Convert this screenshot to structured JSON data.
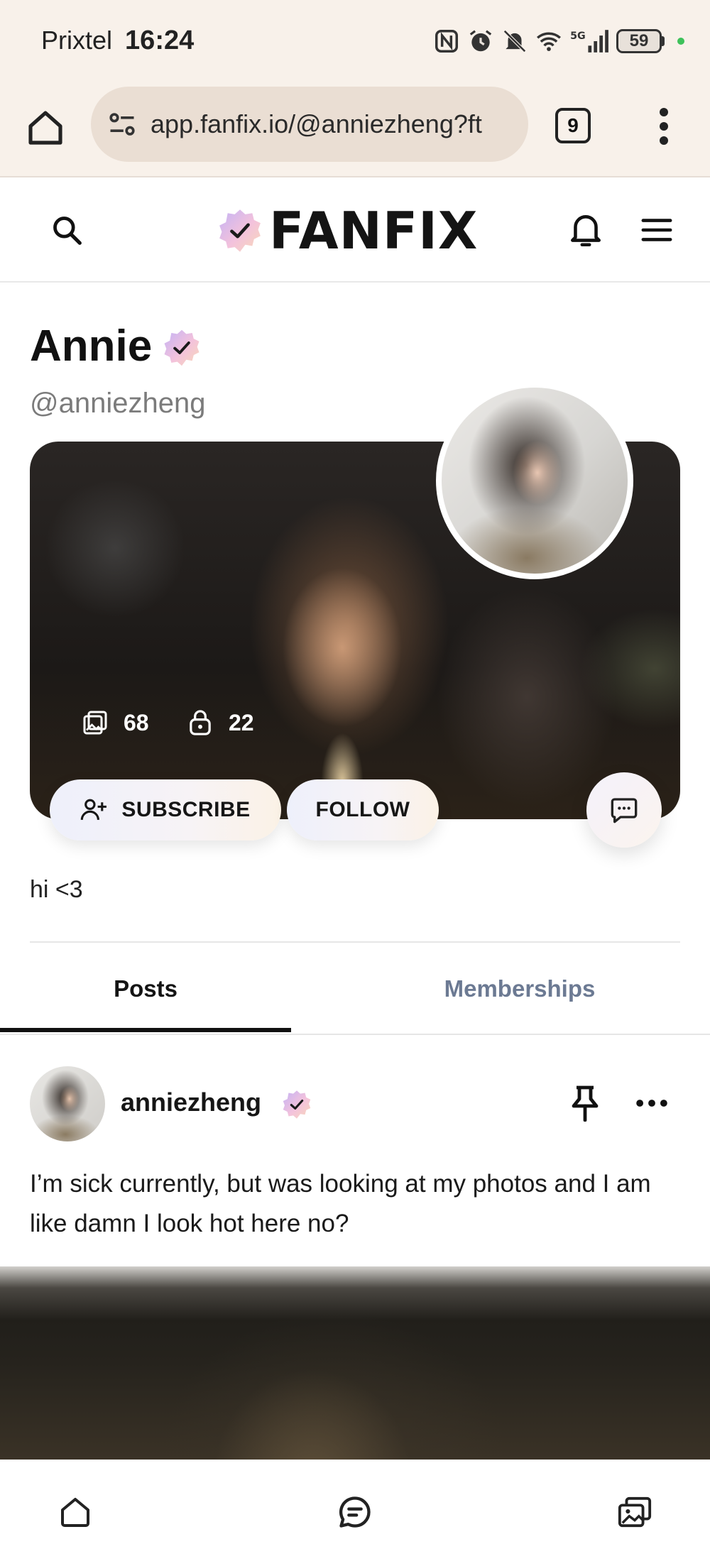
{
  "status_bar": {
    "carrier": "Prixtel",
    "time": "16:24",
    "battery": "59",
    "icons": [
      "nfc-icon",
      "alarm-icon",
      "bell-off-icon",
      "wifi-icon",
      "5g-signal-icon",
      "battery-icon"
    ]
  },
  "browser": {
    "url": "app.fanfix.io/@anniezheng?ft",
    "tab_count": "9",
    "icons": [
      "home-icon",
      "site-settings-icon",
      "tabs-icon",
      "kebab-menu-icon"
    ]
  },
  "site_header": {
    "logo": "FANFIX",
    "icons": [
      "search-icon",
      "verified-badge-icon",
      "bell-icon",
      "hamburger-menu-icon"
    ]
  },
  "profile": {
    "name": "Annie",
    "handle": "@anniezheng",
    "media_count": "68",
    "locked_count": "22",
    "bio": "hi <3",
    "subscribe_label": "SUBSCRIBE",
    "follow_label": "FOLLOW"
  },
  "tabs": [
    {
      "label": "Posts",
      "active": true
    },
    {
      "label": "Memberships",
      "active": false
    }
  ],
  "post": {
    "username": "anniezheng",
    "text": "I’m sick currently, but was looking at my photos and I am like damn I look hot here no?"
  },
  "bottom_nav": {
    "icons": [
      "home-icon",
      "chat-icon",
      "gallery-icon"
    ]
  },
  "colors": {
    "status_bg": "#f8f1ea",
    "url_bg": "#eaded3",
    "tab_inactive": "#6c7a93",
    "accent_gradient": [
      "#c9b4f2",
      "#f6c4d8",
      "#f9dcc0"
    ]
  }
}
